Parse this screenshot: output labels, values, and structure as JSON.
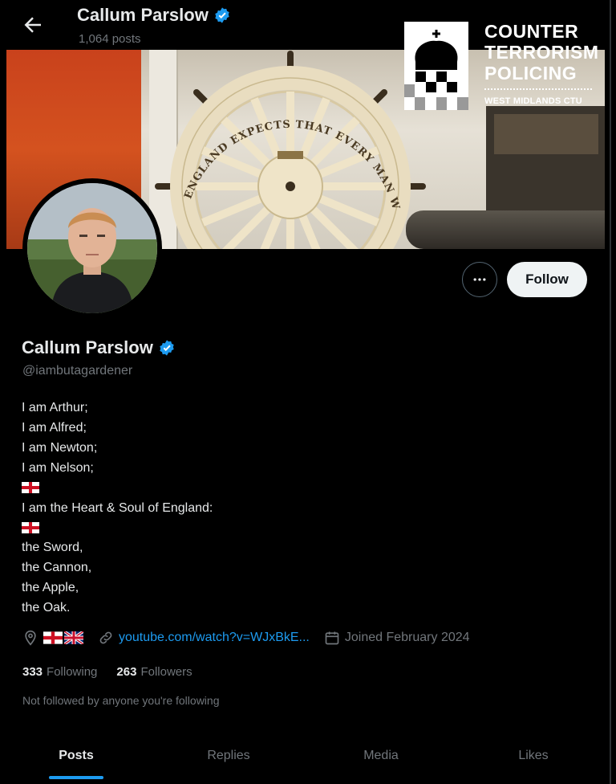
{
  "header": {
    "name": "Callum Parslow",
    "posts_count": "1,064 posts"
  },
  "banner": {
    "wheel_inscription": "ENGLAND EXPECTS THAT EVERY MAN WILL DO HIS DUTY"
  },
  "logo": {
    "line1": "COUNTER",
    "line2": "TERRORISM",
    "line3": "POLICING",
    "subtitle": "WEST MIDLANDS CTU"
  },
  "actions": {
    "follow_label": "Follow"
  },
  "profile": {
    "name": "Callum Parslow",
    "handle": "@iambutagardener",
    "bio_lines": [
      "I am Arthur;",
      "I am Alfred;",
      "I am Newton;",
      "I am Nelson;",
      "I am the Heart & Soul of England:",
      "the Sword,",
      "the Cannon,",
      "the Apple,",
      "the Oak."
    ],
    "link": "youtube.com/watch?v=WJxBkE...",
    "joined": "Joined February 2024",
    "following_count": "333",
    "following_label": "Following",
    "followers_count": "263",
    "followers_label": "Followers",
    "not_followed": "Not followed by anyone you're following"
  },
  "tabs": [
    {
      "label": "Posts"
    },
    {
      "label": "Replies"
    },
    {
      "label": "Media"
    },
    {
      "label": "Likes"
    }
  ],
  "colors": {
    "accent": "#1d9bf0",
    "background": "#000000",
    "muted": "#71767b"
  },
  "icons": {
    "back": "arrow-left-icon",
    "verified": "verified-badge-icon",
    "more": "more-horizontal-icon",
    "location": "location-pin-icon",
    "link": "link-icon",
    "calendar": "calendar-icon",
    "england_flag": "england-flag-icon",
    "uk_flag": "union-flag-icon"
  }
}
